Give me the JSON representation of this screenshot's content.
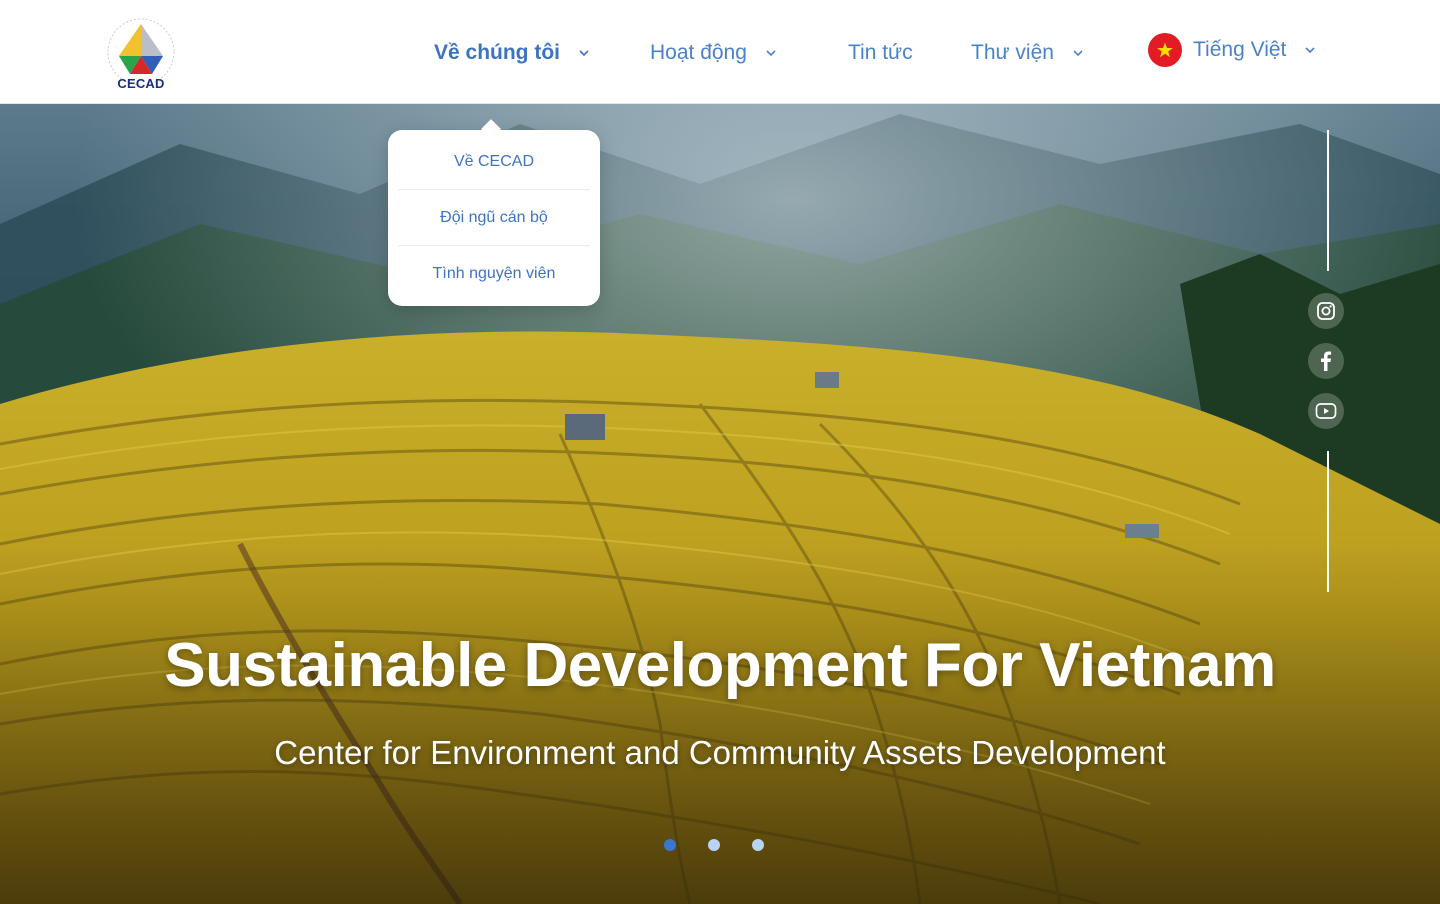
{
  "brand": {
    "logo_text": "CECAD"
  },
  "nav": {
    "items": [
      {
        "label": "Về chúng tôi",
        "has_dropdown": true,
        "active": true
      },
      {
        "label": "Hoạt động",
        "has_dropdown": true,
        "active": false
      },
      {
        "label": "Tin tức",
        "has_dropdown": false,
        "active": false
      },
      {
        "label": "Thư viện",
        "has_dropdown": true,
        "active": false
      }
    ],
    "language": {
      "label": "Tiếng Việt",
      "flag": "vietnam-flag-icon"
    }
  },
  "dropdown": {
    "items": [
      "Về CECAD",
      "Đội ngũ cán bộ",
      "Tình nguyện viên"
    ]
  },
  "hero": {
    "title": "Sustainable Development For Vietnam",
    "subtitle": "Center for Environment and Community Assets Development",
    "slides": 3,
    "active_slide": 1
  },
  "social": {
    "icons": [
      "instagram-icon",
      "facebook-icon",
      "youtube-icon"
    ]
  },
  "colors": {
    "accent": "#3d74c2",
    "nav_text": "#4a82c9",
    "flag_red": "#e21b25",
    "flag_star": "#ffde00"
  }
}
